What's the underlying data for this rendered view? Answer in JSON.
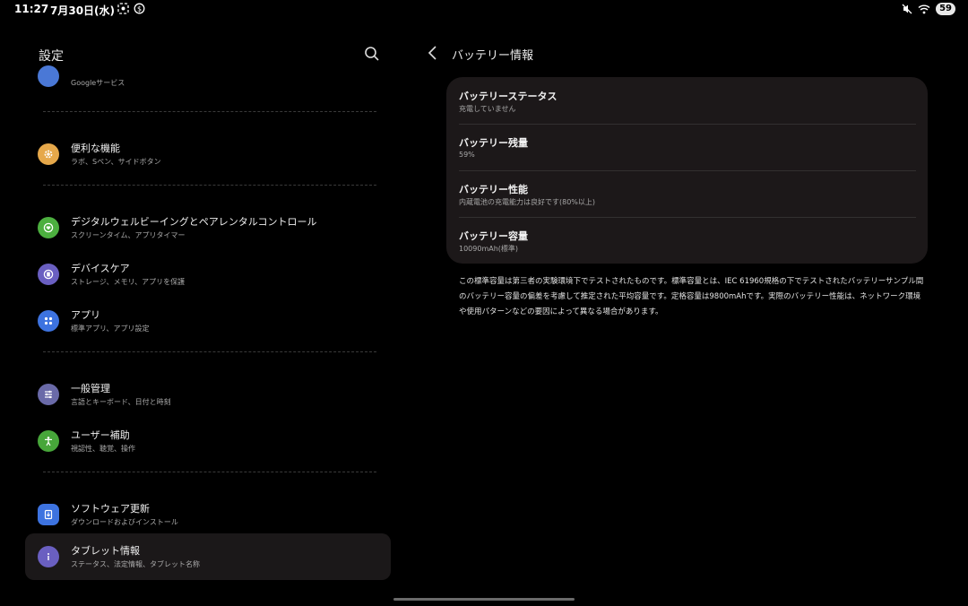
{
  "statusbar": {
    "time": "11:27",
    "date": "7月30日(水)",
    "battery": "59"
  },
  "left": {
    "title": "設定",
    "partial_item_subtitle": "Googleサービス",
    "items": [
      {
        "title": "便利な機能",
        "subtitle": "ラボ、Sペン、サイドボタン",
        "icon": "gear-plus-icon",
        "color": "#e6a84a"
      },
      {
        "title": "デジタルウェルビーイングとペアレンタルコントロール",
        "subtitle": "スクリーンタイム、アプリタイマー",
        "icon": "heart-ring-icon",
        "color": "#4caf3f"
      },
      {
        "title": "デバイスケア",
        "subtitle": "ストレージ、メモリ、アプリを保護",
        "icon": "device-care-icon",
        "color": "#6a5fc1"
      },
      {
        "title": "アプリ",
        "subtitle": "標準アプリ、アプリ設定",
        "icon": "apps-grid-icon",
        "color": "#3d73e0"
      },
      {
        "title": "一般管理",
        "subtitle": "言語とキーボード、日付と時刻",
        "icon": "sliders-icon",
        "color": "#6a6aa8"
      },
      {
        "title": "ユーザー補助",
        "subtitle": "視認性、聴覚、操作",
        "icon": "accessibility-icon",
        "color": "#47a63a"
      },
      {
        "title": "ソフトウェア更新",
        "subtitle": "ダウンロードおよびインストール",
        "icon": "update-icon",
        "color": "#3d73e0"
      },
      {
        "title": "タブレット情報",
        "subtitle": "ステータス、法定情報、タブレット名称",
        "icon": "info-icon",
        "color": "#6a5fc1"
      }
    ]
  },
  "right": {
    "title": "バッテリー情報",
    "rows": [
      {
        "title": "バッテリーステータス",
        "subtitle": "充電していません"
      },
      {
        "title": "バッテリー残量",
        "subtitle": "59%"
      },
      {
        "title": "バッテリー性能",
        "subtitle": "内蔵電池の充電能力は良好です(80%以上)"
      },
      {
        "title": "バッテリー容量",
        "subtitle": "10090mAh(標準)"
      }
    ],
    "note": "この標準容量は第三者の実験環境下でテストされたものです。標準容量とは、IEC 61960規格の下でテストされたバッテリーサンプル間のバッテリー容量の偏差を考慮して推定された平均容量です。定格容量は9800mAhです。実際のバッテリー性能は、ネットワーク環境や使用パターンなどの要因によって異なる場合があります。"
  }
}
